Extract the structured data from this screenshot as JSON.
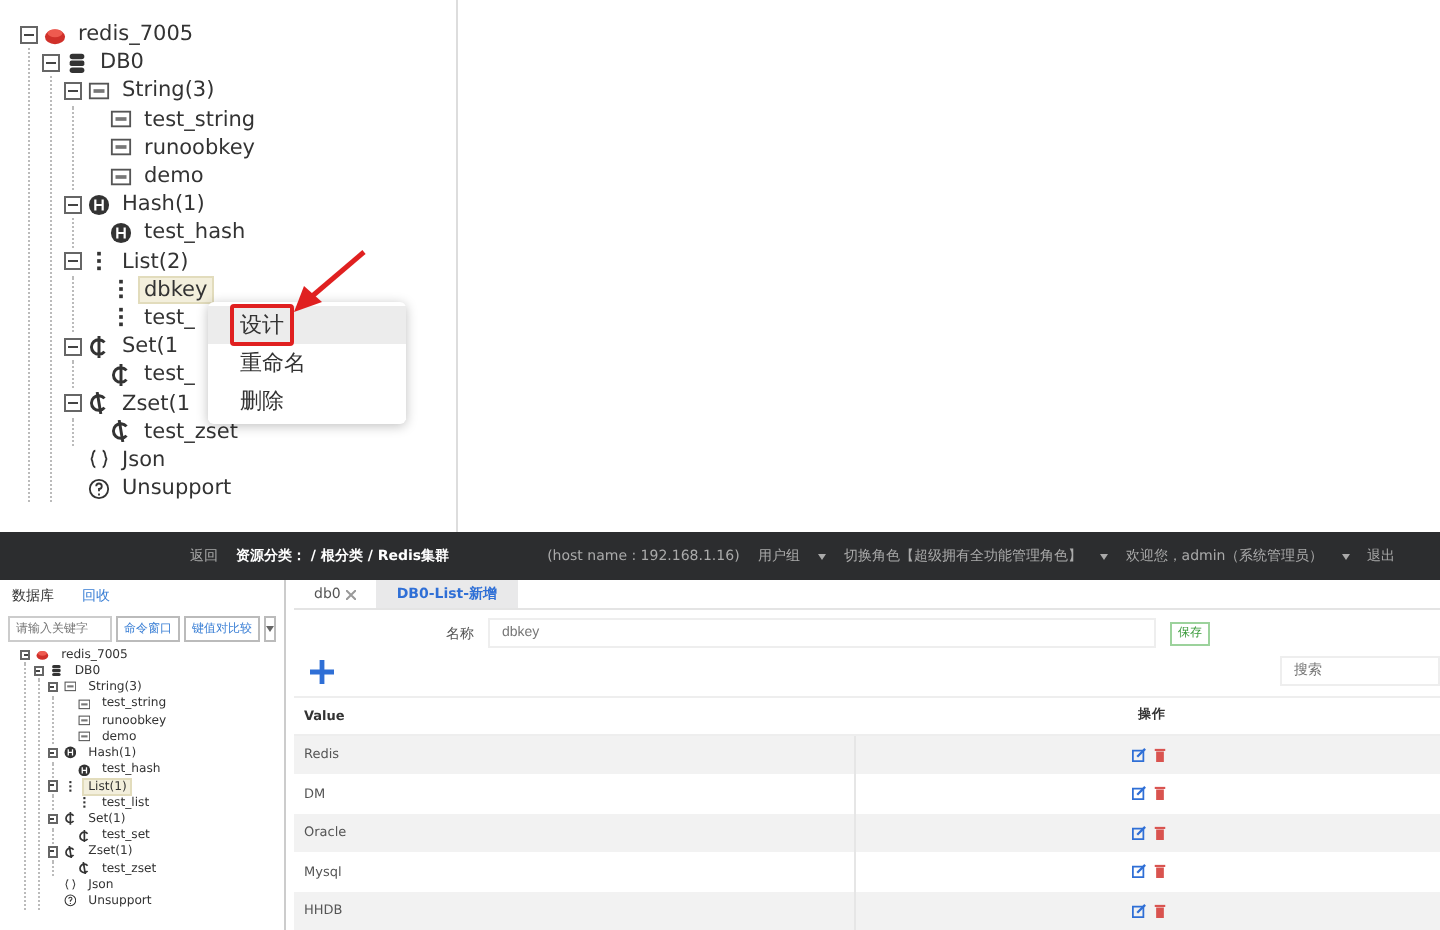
{
  "top_tree": [
    {
      "label": "redis_7005",
      "kind": "server",
      "expanded": true,
      "selected": false,
      "children": [
        {
          "label": "DB0",
          "kind": "db",
          "expanded": true,
          "selected": false,
          "children": [
            {
              "label": "String(3)",
              "kind": "string",
              "expanded": true,
              "selected": false,
              "children": [
                {
                  "label": "test_string",
                  "kind": "string",
                  "selected": false
                },
                {
                  "label": "runoobkey",
                  "kind": "string",
                  "selected": false
                },
                {
                  "label": "demo",
                  "kind": "string",
                  "selected": false
                }
              ]
            },
            {
              "label": "Hash(1)",
              "kind": "hash",
              "expanded": true,
              "selected": false,
              "children": [
                {
                  "label": "test_hash",
                  "kind": "hash",
                  "selected": false
                }
              ]
            },
            {
              "label": "List(2)",
              "kind": "list",
              "expanded": true,
              "selected": false,
              "children": [
                {
                  "label": "dbkey",
                  "kind": "list",
                  "selected": true
                },
                {
                  "label": "test_",
                  "kind": "list",
                  "selected": false
                }
              ]
            },
            {
              "label": "Set(1",
              "kind": "set",
              "expanded": true,
              "selected": false,
              "children": [
                {
                  "label": "test_",
                  "kind": "set",
                  "selected": false
                }
              ]
            },
            {
              "label": "Zset(1",
              "kind": "zset",
              "expanded": true,
              "selected": false,
              "children": [
                {
                  "label": "test_zset",
                  "kind": "zset",
                  "selected": false
                }
              ]
            },
            {
              "label": "Json",
              "kind": "json",
              "selected": false
            },
            {
              "label": "Unsupport",
              "kind": "unsupport",
              "selected": false
            }
          ]
        }
      ]
    }
  ],
  "context_menu": [
    {
      "label": "设计",
      "selected": true
    },
    {
      "label": "重命名",
      "selected": false
    },
    {
      "label": "删除",
      "selected": false
    }
  ],
  "header": {
    "back": "返回",
    "breadcrumb": "资源分类： / 根分类 / Redis集群",
    "host": "(host name : 192.168.1.16)",
    "user_group": "用户组",
    "role": "切换角色【超级拥有全功能管理角色】",
    "welcome": "欢迎您，admin（系统管理员）",
    "logout": "退出"
  },
  "left_panel": {
    "tabs": [
      {
        "label": "数据库",
        "selected": true
      },
      {
        "label": "回收",
        "selected": false
      }
    ],
    "search": {
      "placeholder": "请输入关键字"
    },
    "buttons": [
      "命令窗口",
      "键值对比较"
    ],
    "tree": [
      {
        "label": "redis_7005",
        "kind": "server",
        "expanded": true,
        "selected": false,
        "children": [
          {
            "label": "DB0",
            "kind": "db",
            "expanded": true,
            "selected": false,
            "children": [
              {
                "label": "String(3)",
                "kind": "string",
                "expanded": true,
                "selected": false,
                "children": [
                  {
                    "label": "test_string",
                    "kind": "string",
                    "selected": false
                  },
                  {
                    "label": "runoobkey",
                    "kind": "string",
                    "selected": false
                  },
                  {
                    "label": "demo",
                    "kind": "string",
                    "selected": false
                  }
                ]
              },
              {
                "label": "Hash(1)",
                "kind": "hash",
                "expanded": true,
                "selected": false,
                "children": [
                  {
                    "label": "test_hash",
                    "kind": "hash",
                    "selected": false
                  }
                ]
              },
              {
                "label": "List(1)",
                "kind": "list",
                "expanded": true,
                "selected": true,
                "children": [
                  {
                    "label": "test_list",
                    "kind": "list",
                    "selected": false
                  }
                ]
              },
              {
                "label": "Set(1)",
                "kind": "set",
                "expanded": true,
                "selected": false,
                "children": [
                  {
                    "label": "test_set",
                    "kind": "set",
                    "selected": false
                  }
                ]
              },
              {
                "label": "Zset(1)",
                "kind": "zset",
                "expanded": true,
                "selected": false,
                "children": [
                  {
                    "label": "test_zset",
                    "kind": "zset",
                    "selected": false
                  }
                ]
              },
              {
                "label": "Json",
                "kind": "json",
                "selected": false
              },
              {
                "label": "Unsupport",
                "kind": "unsupport",
                "selected": false
              }
            ]
          }
        ]
      }
    ]
  },
  "editor": {
    "tabs": [
      {
        "label": "db0",
        "selected": false
      },
      {
        "label": "DB0-List-新增",
        "selected": true
      }
    ],
    "name_label": "名称",
    "name_value": "dbkey",
    "save": "保存",
    "search": {
      "placeholder": "搜索"
    },
    "table": {
      "columns": [
        "Value",
        "操作"
      ],
      "rows": [
        {
          "value": "Redis"
        },
        {
          "value": "DM"
        },
        {
          "value": "Oracle"
        },
        {
          "value": "Mysql"
        },
        {
          "value": "HHDB"
        }
      ]
    }
  }
}
